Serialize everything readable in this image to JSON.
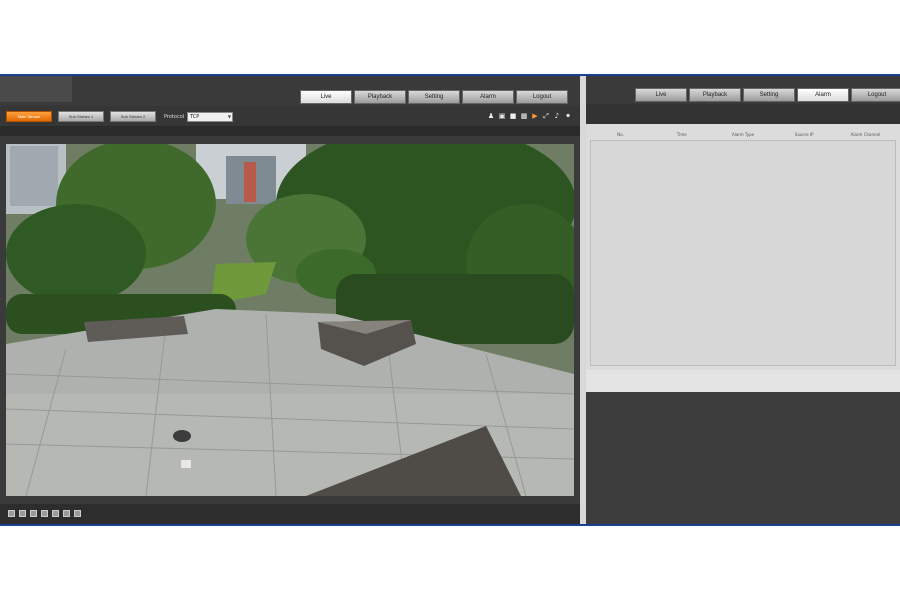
{
  "left_window": {
    "logo_text": "",
    "tabs": [
      {
        "label": "Live",
        "active": true
      },
      {
        "label": "Playback",
        "active": false
      },
      {
        "label": "Setting",
        "active": false
      },
      {
        "label": "Alarm",
        "active": false
      },
      {
        "label": "Logout",
        "active": false
      }
    ],
    "stream_buttons": [
      {
        "label": "Main Stream",
        "active": true
      },
      {
        "label": "Sub Stream 1",
        "active": false
      },
      {
        "label": "Sub Stream 2",
        "active": false
      }
    ],
    "protocol": {
      "label": "Protocol",
      "value": "TCP"
    },
    "toolbar_icons": [
      "user-icon",
      "snapshot-icon",
      "record-icon",
      "zoom-icon",
      "talk-icon",
      "fullscreen-icon",
      "audio-icon",
      "mic-icon"
    ],
    "info": {
      "channel": "",
      "resolution": ""
    },
    "bottom_icons": [
      "ptz-icon",
      "image-adjust-icon",
      "zoom-focus-icon",
      "layout-icon",
      "color-icon",
      "fit-icon",
      "fullscreen-icon"
    ]
  },
  "right_window": {
    "tabs": [
      {
        "label": "Live",
        "active": false
      },
      {
        "label": "Playback",
        "active": false
      },
      {
        "label": "Setting",
        "active": false
      },
      {
        "label": "Alarm",
        "active": true
      },
      {
        "label": "Logout",
        "active": false
      }
    ],
    "alarm_table": {
      "columns": [
        "No.",
        "Time",
        "Alarm Type",
        "Source IP",
        "Alarm Channel"
      ],
      "rows": []
    }
  },
  "colors": {
    "accent_orange": "#f07a10",
    "frame_border": "#1f3f8f",
    "panel_dark": "#3a3a3a"
  }
}
